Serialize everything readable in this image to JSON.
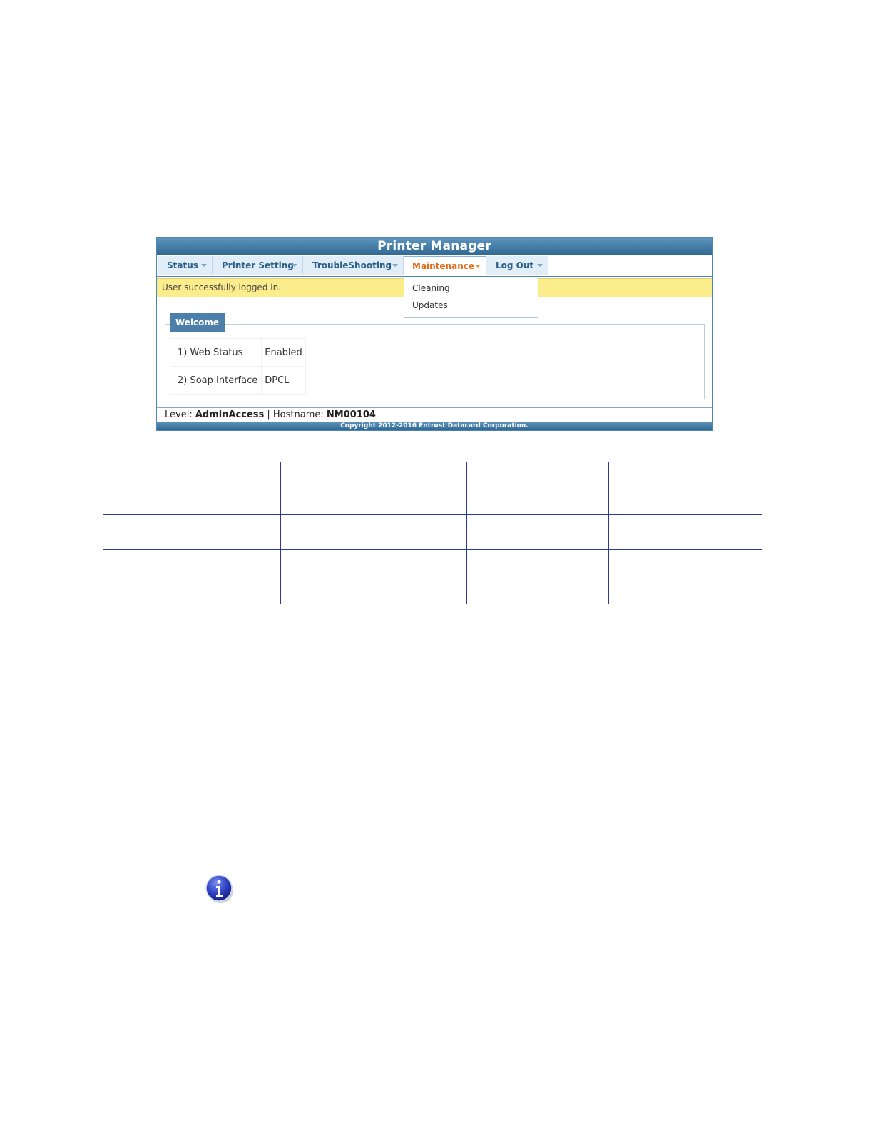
{
  "app": {
    "title": "Printer Manager"
  },
  "menu": {
    "tabs": [
      {
        "label": "Status"
      },
      {
        "label": "Printer Setting"
      },
      {
        "label": "TroubleShooting"
      },
      {
        "label": "Maintenance"
      },
      {
        "label": "Log Out"
      }
    ],
    "active_tab": "Maintenance",
    "dropdown": [
      "Cleaning",
      "Updates"
    ]
  },
  "alert": {
    "message": "User successfully logged in."
  },
  "welcome": {
    "legend": "Welcome",
    "rows": [
      {
        "name": "1) Web Status",
        "value": "Enabled"
      },
      {
        "name": "2) Soap Interface",
        "value": "DPCL"
      }
    ]
  },
  "footer": {
    "level_label": "Level:",
    "level_value": "AdminAccess",
    "separator": "|",
    "hostname_label": "Hostname:",
    "hostname_value": "NM00104",
    "copyright": "Copyright 2012-2016 Entrust Datacard Corporation."
  },
  "colors": {
    "header_blue": "#2f6893",
    "tab_text": "#2d5f8b",
    "active_tab_text": "#e36c1a",
    "alert_bg": "#fbed8c",
    "doc_rule": "#2b3990"
  },
  "icons": {
    "info": "info-icon",
    "caret": "chevron-down-icon"
  }
}
